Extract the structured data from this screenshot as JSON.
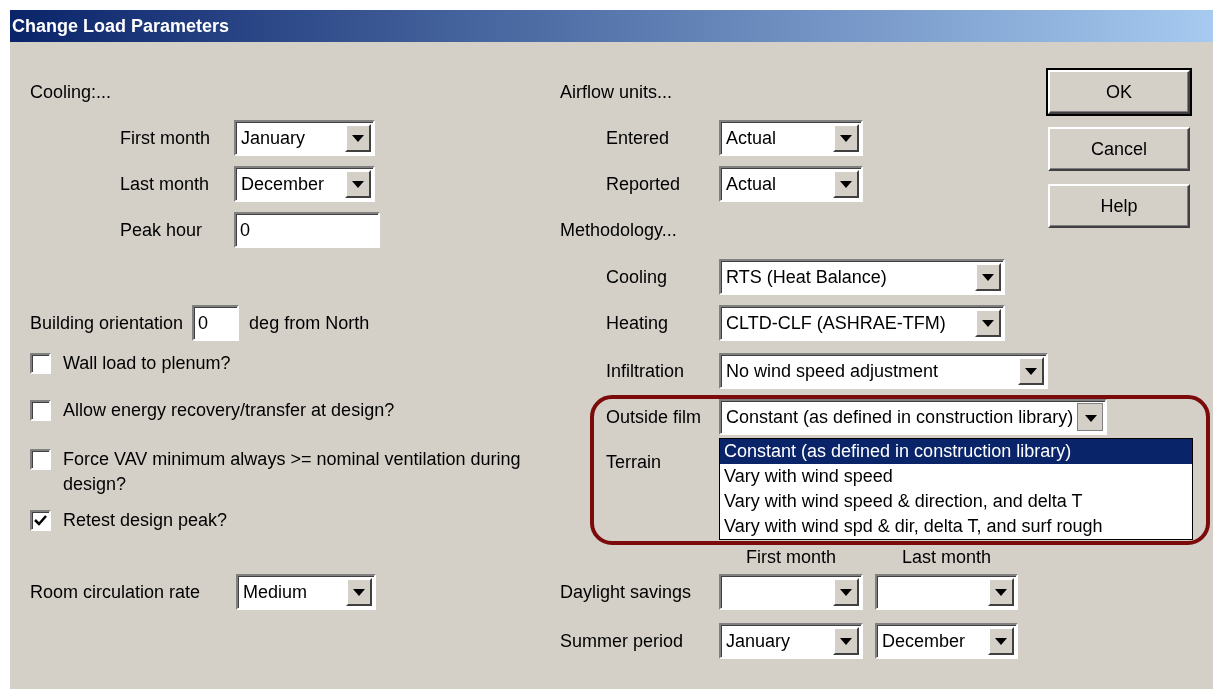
{
  "window": {
    "title": "Change Load Parameters"
  },
  "cooling": {
    "heading": "Cooling:...",
    "fields": [
      {
        "kind": "combo",
        "label": "First month",
        "value": "January"
      },
      {
        "kind": "combo",
        "label": "Last month",
        "value": "December"
      },
      {
        "kind": "text",
        "label": "Peak hour",
        "value": "0"
      }
    ]
  },
  "orientation": {
    "label": "Building orientation",
    "value": "0",
    "unit": "deg from North"
  },
  "options": [
    {
      "label": "Wall load to plenum?",
      "checked": false
    },
    {
      "label": "Allow energy recovery/transfer at design?",
      "checked": false
    },
    {
      "label": "Force VAV minimum always >= nominal ventilation during design?",
      "checked": false
    },
    {
      "label": "Retest design peak?",
      "checked": true
    }
  ],
  "room_circulation": {
    "label": "Room circulation rate",
    "value": "Medium"
  },
  "airflow": {
    "heading": "Airflow units...",
    "fields": [
      {
        "label": "Entered",
        "value": "Actual"
      },
      {
        "label": "Reported",
        "value": "Actual"
      }
    ]
  },
  "methodology": {
    "heading": "Methodology...",
    "fields": [
      {
        "label": "Cooling",
        "value": "RTS (Heat Balance)"
      },
      {
        "label": "Heating",
        "value": "CLTD-CLF (ASHRAE-TFM)"
      },
      {
        "label": "Infiltration",
        "value": "No wind speed adjustment"
      },
      {
        "label": "Outside film",
        "value": "Constant (as defined in construction library)",
        "expanded": true
      },
      {
        "label": "Terrain"
      }
    ]
  },
  "outside_film_list": {
    "options": [
      {
        "label": "Constant (as defined in construction library)",
        "selected": true
      },
      {
        "label": "Vary with wind speed",
        "selected": false
      },
      {
        "label": "Vary with wind speed & direction, and delta T",
        "selected": false
      },
      {
        "label": "Vary with wind spd & dir, delta T, and surf rough",
        "selected": false
      }
    ]
  },
  "periods": {
    "column_1": "First month",
    "column_2": "Last month",
    "rows": [
      {
        "label": "Daylight savings"
      },
      {
        "label": "Summer period",
        "first": "January",
        "last": "December"
      }
    ]
  },
  "buttons": [
    {
      "label": "OK",
      "default": true
    },
    {
      "label": "Cancel",
      "default": false
    },
    {
      "label": "Help",
      "default": false
    }
  ]
}
